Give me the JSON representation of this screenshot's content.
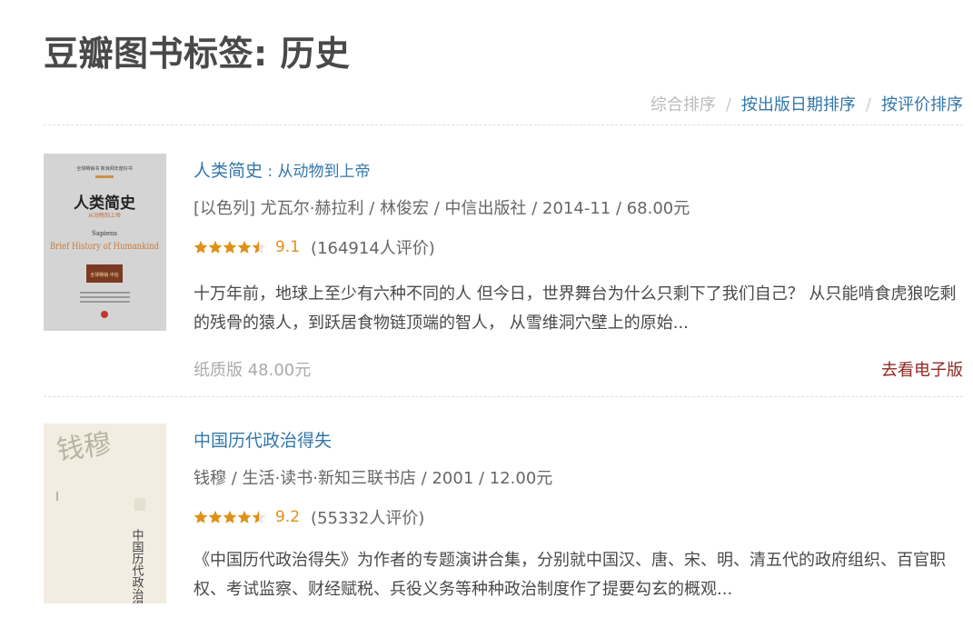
{
  "page": {
    "title": "豆瓣图书标签: 历史"
  },
  "sort": {
    "options": [
      "综合排序",
      "按出版日期排序",
      "按评价排序"
    ],
    "separator": "/"
  },
  "books": [
    {
      "title": "人类简史",
      "subtitle": " : 从动物到上帝",
      "pub": "[以色列] 尤瓦尔·赫拉利 / 林俊宏 / 中信出版社 / 2014-11 / 68.00元",
      "rating": "9.1",
      "stars": 4.5,
      "count": "(164914人评价)",
      "intro": "十万年前，地球上至少有六种不同的人 但今日，世界舞台为什么只剩下了我们自己？ 从只能啃食虎狼吃剩的残骨的猿人，到跃居食物链顶端的智人， 从雪维洞穴壁上的原始...",
      "paper_price": "纸质版 48.00元",
      "ebook_link": "去看电子版",
      "cover": {
        "top": "全球畅销书 新浪网年度好书",
        "cn_title": "人类简史",
        "cn_sub": "从动物到上帝",
        "en_small": "Sapiens",
        "en_title": "Brief History of Humankind",
        "badge": "全球畅销 中信"
      }
    },
    {
      "title": "中国历代政治得失",
      "subtitle": "",
      "pub": "钱穆 / 生活·读书·新知三联书店 / 2001 / 12.00元",
      "rating": "9.2",
      "stars": 4.5,
      "count": "(55332人评价)",
      "intro": "《中国历代政治得失》为作者的专题演讲合集，分别就中国汉、唐、宋、明、清五代的政府组织、百官职权、考试监察、财经赋税、兵役义务等种种政治制度作了提要勾玄的概观...",
      "cover": {
        "author": "钱穆",
        "title": "中国历代政治得失"
      }
    }
  ],
  "colors": {
    "link": "#3377aa",
    "star": "#e09015",
    "ebook": "#8f2a24"
  }
}
